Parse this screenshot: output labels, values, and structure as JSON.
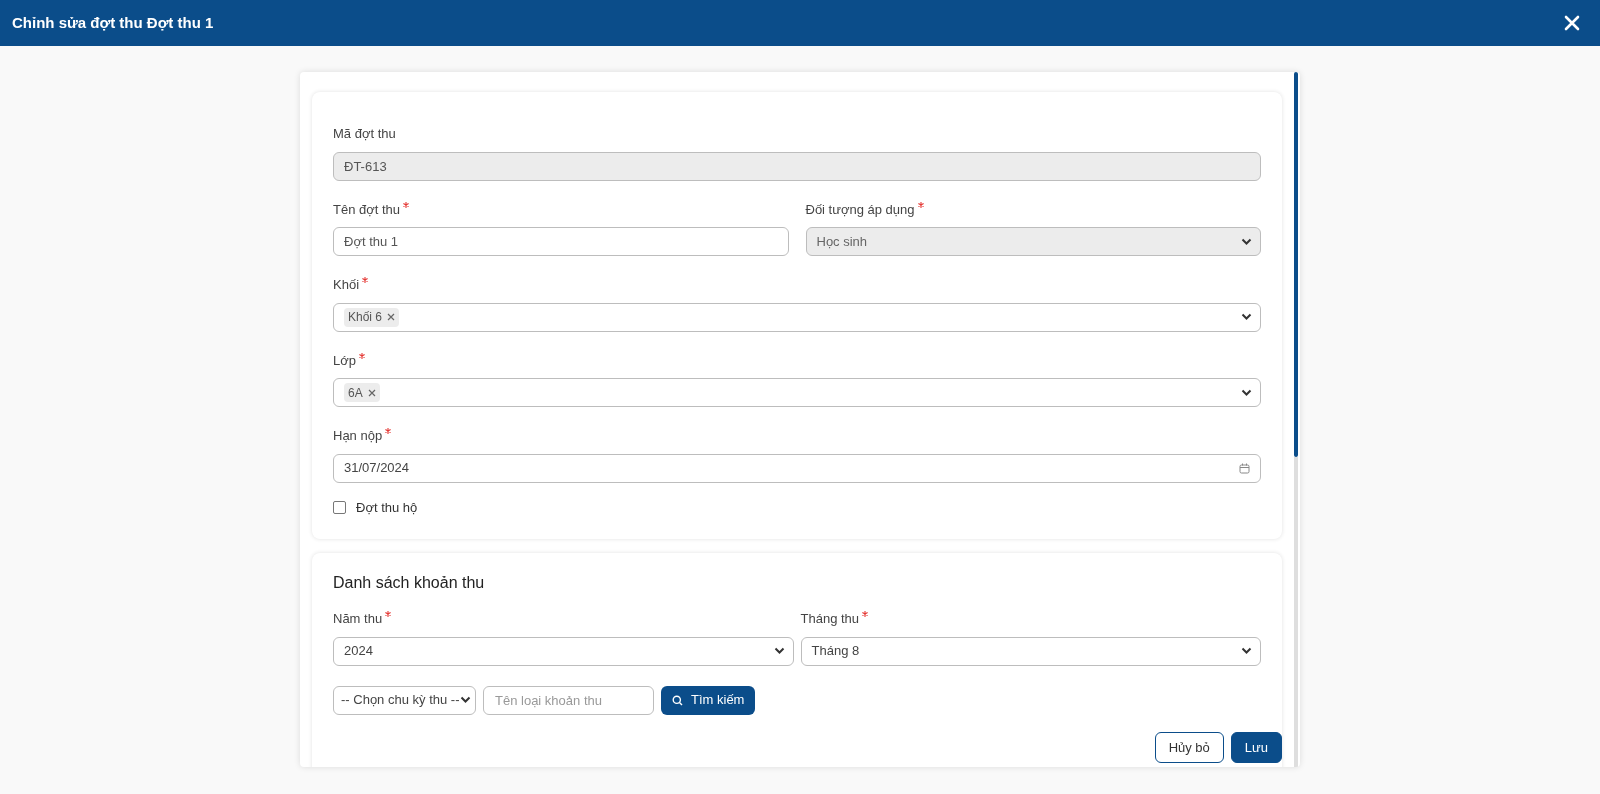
{
  "window": {
    "title": "Chỉnh sửa đợt thu Đợt thu 1"
  },
  "info_card": {
    "rows": [
      {
        "fields": [
          {
            "kind": "text",
            "label": "Mã đợt thu",
            "required": false,
            "value": "ĐT-613",
            "disabled": true
          }
        ]
      },
      {
        "fields": [
          {
            "kind": "text",
            "label": "Tên đợt thu",
            "required": true,
            "value": "Đợt thu 1",
            "disabled": false
          },
          {
            "kind": "select",
            "label": "Đối tượng áp dụng",
            "required": true,
            "value": "Học sinh",
            "disabled": true
          }
        ]
      },
      {
        "fields": [
          {
            "kind": "tags",
            "label": "Khối",
            "required": true,
            "tags": [
              "Khối 6"
            ]
          }
        ]
      },
      {
        "fields": [
          {
            "kind": "tags",
            "label": "Lớp",
            "required": true,
            "tags": [
              "6A"
            ]
          }
        ]
      },
      {
        "fields": [
          {
            "kind": "date",
            "label": "Hạn nộp",
            "required": true,
            "value": "31/07/2024"
          }
        ]
      },
      {
        "fields": [
          {
            "kind": "checkbox",
            "label": "Đợt thu hộ",
            "checked": false
          }
        ]
      }
    ]
  },
  "fee_list": {
    "title": "Danh sách khoản thu",
    "rows": [
      {
        "fields": [
          {
            "kind": "select",
            "label": "Năm thu",
            "required": true,
            "value": "2024",
            "disabled": false
          },
          {
            "kind": "select",
            "label": "Tháng thu",
            "required": true,
            "value": "Tháng 8",
            "disabled": false
          }
        ]
      }
    ],
    "filter": {
      "cycle": "-- Chọn chu kỳ thu --",
      "search_placeholder": "Tên loại khoản thu",
      "search_button": "Tìm kiếm"
    }
  },
  "buttons": [
    {
      "kind": "secondary",
      "label": "Hủy bỏ"
    },
    {
      "kind": "primary",
      "label": "Lưu"
    }
  ]
}
